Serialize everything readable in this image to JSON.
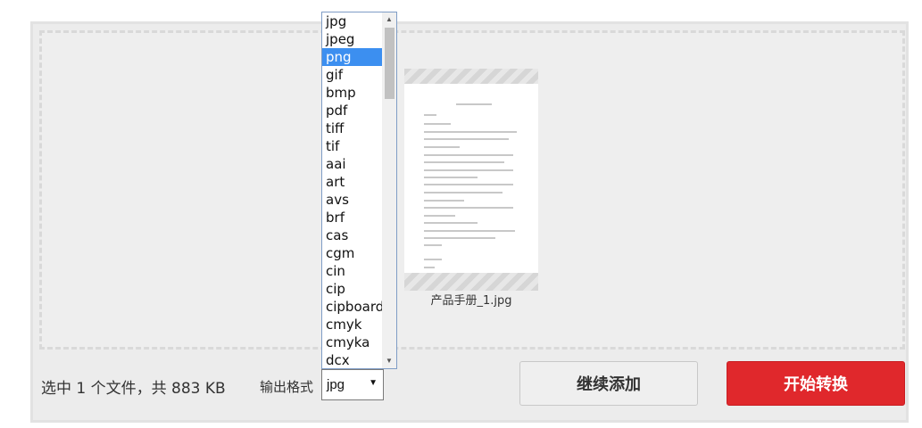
{
  "thumbnail": {
    "filename": "产品手册_1.jpg"
  },
  "footer": {
    "selection_text": "选中 1 个文件，共 883 KB",
    "format_label": "输出格式",
    "format_value": "jpg",
    "format_arrow": "▼"
  },
  "buttons": {
    "continue_label": "继续添加",
    "start_label": "开始转换"
  },
  "dropdown": {
    "options": [
      "jpg",
      "jpeg",
      "png",
      "gif",
      "bmp",
      "pdf",
      "tiff",
      "tif",
      "aai",
      "art",
      "avs",
      "brf",
      "cas",
      "cgm",
      "cin",
      "cip",
      "cipboard",
      "cmyk",
      "cmyka",
      "dcx"
    ],
    "highlighted": "png",
    "scroll_up_glyph": "▲",
    "scroll_down_glyph": "▼"
  },
  "colors": {
    "accent": "#e0282c",
    "highlight": "#3c8ff0",
    "panel_bg": "#ececec",
    "dropdown_border": "#7f9dc6"
  },
  "icons": [
    "dropdown-arrow-icon",
    "scroll-up-icon",
    "scroll-down-icon"
  ]
}
